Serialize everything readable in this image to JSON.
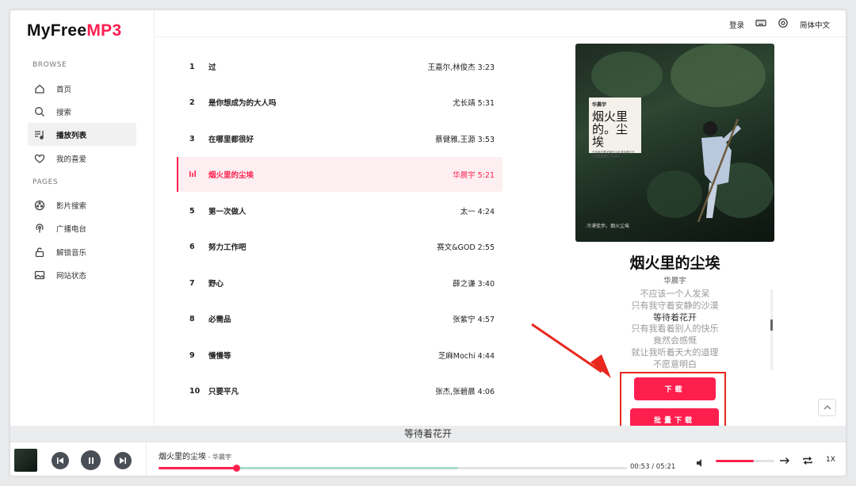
{
  "app": {
    "logo_main": "MyFree",
    "logo_accent": "MP3"
  },
  "sidebar": {
    "browse_label": "BROWSE",
    "pages_label": "PAGES",
    "browse_items": [
      {
        "label": "首页",
        "icon": "home-icon"
      },
      {
        "label": "搜索",
        "icon": "search-icon"
      },
      {
        "label": "播放列表",
        "icon": "playlist-icon",
        "active": true
      },
      {
        "label": "我的喜爱",
        "icon": "heart-icon"
      }
    ],
    "page_items": [
      {
        "label": "影片搜索",
        "icon": "film-reel-icon"
      },
      {
        "label": "广播电台",
        "icon": "radio-icon"
      },
      {
        "label": "解锁音乐",
        "icon": "unlock-icon"
      },
      {
        "label": "网站状态",
        "icon": "image-icon"
      }
    ]
  },
  "topbar": {
    "login": "登录",
    "keyboard_icon": "keyboard-icon",
    "settings_icon": "gear-icon",
    "language": "简体中文"
  },
  "tracks": [
    {
      "num": "1",
      "title": "过",
      "artist_time": "王嘉尔,林俊杰 3:23"
    },
    {
      "num": "2",
      "title": "是你想成为的大人吗",
      "artist_time": "尤长靖 5:31"
    },
    {
      "num": "3",
      "title": "在哪里都很好",
      "artist_time": "蔡健雅,王源 3:53"
    },
    {
      "num": "",
      "title": "烟火里的尘埃",
      "artist_time": "华晨宇 5:21",
      "playing": true
    },
    {
      "num": "5",
      "title": "第一次做人",
      "artist_time": "太一 4:24"
    },
    {
      "num": "6",
      "title": "努力工作吧",
      "artist_time": "赛文&GOD 2:55"
    },
    {
      "num": "7",
      "title": "野心",
      "artist_time": "薛之谦 3:40"
    },
    {
      "num": "8",
      "title": "必需品",
      "artist_time": "张紫宁 4:57"
    },
    {
      "num": "9",
      "title": "慢慢等",
      "artist_time": "芝麻Mochi 4:44"
    },
    {
      "num": "10",
      "title": "只要平凡",
      "artist_time": "张杰,张碧晨 4:06"
    }
  ],
  "now_playing": {
    "title": "烟火里的尘埃",
    "artist": "华晨宇",
    "cover": {
      "card_top": "华晨宇",
      "card_title_1": "烟火里",
      "card_title_2": "的。尘埃",
      "card_small": "只有我守着安静的沙漠 等待着花开 只有我看着别人的快乐",
      "caption": "冷漠徒步。烟火尘埃"
    },
    "lyrics": [
      "不应该一个人发呆",
      "只有我守着安静的沙漠",
      "等待着花开",
      "只有我看着别人的快乐",
      "竟然会感慨",
      "就让我听着天大的道理",
      "不愿意明白"
    ],
    "current_lyric_index": 2,
    "current_lyric": "等待着花开"
  },
  "actions": {
    "download": "下载",
    "batch_download": "批量下载"
  },
  "player": {
    "title": "烟火里的尘埃",
    "separator": " - ",
    "artist": "华晨宇",
    "time": "00:53 / 05:21",
    "progress_fraction": 0.165,
    "buffer_fraction": 0.64,
    "volume_fraction": 0.65,
    "speed": "1X"
  },
  "colors": {
    "accent": "#ff1f4f",
    "annotation_red": "#e8281f"
  }
}
